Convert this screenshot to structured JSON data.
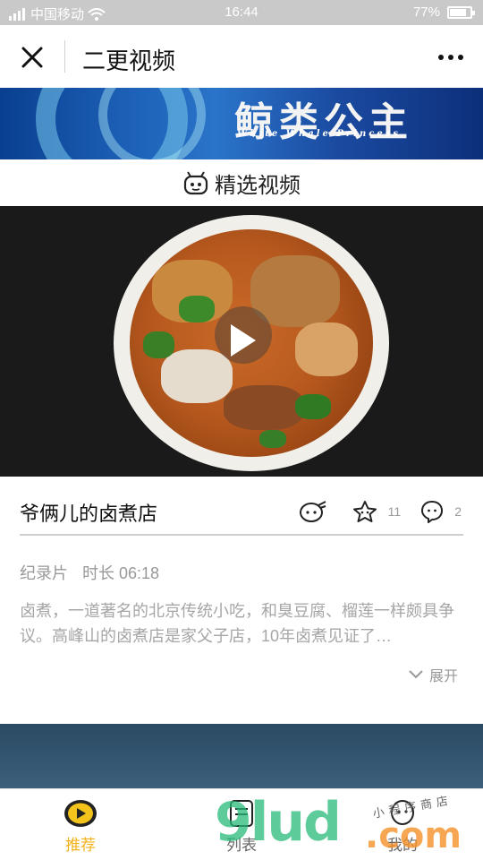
{
  "status_bar": {
    "carrier": "中国移动",
    "time": "16:44",
    "battery_text": "77%",
    "battery_level": 0.77
  },
  "nav": {
    "title": "二更视频",
    "close_icon": "close-icon",
    "more_icon": "more-dots-icon"
  },
  "banner": {
    "title": "鲸类公主",
    "subtitle": "White Whale Princess"
  },
  "section": {
    "title": "精选视频",
    "icon": "tv-robot-icon"
  },
  "video": {
    "title": "爷俩儿的卤煮店",
    "like_count": "11",
    "comment_count": "2",
    "category": "纪录片",
    "duration": "时长 06:18",
    "description": "卤煮，一道著名的北京传统小吃，和臭豆腐、榴莲一样颇具争议。高峰山的卤煮店是家父子店，10年卤煮见证了…",
    "expand_label": "展开"
  },
  "tabs": [
    {
      "label": "推荐",
      "icon": "recommend-play-icon",
      "active": true
    },
    {
      "label": "列表",
      "icon": "list-icon",
      "active": false
    },
    {
      "label": "我的",
      "icon": "profile-icon",
      "active": false
    }
  ],
  "watermark": {
    "main": "9lud",
    "suffix": ".com",
    "handwriting": "小程序商店"
  },
  "colors": {
    "accent": "#f3b21b",
    "status_bar": "#c9c9c9",
    "watermark_green": "#28b978",
    "watermark_orange": "#f59128"
  }
}
